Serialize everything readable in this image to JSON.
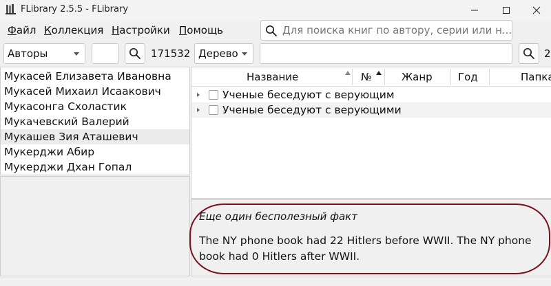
{
  "window": {
    "title": "FLibrary 2.5.5 - FLibrary",
    "controls": [
      "minimize",
      "maximize",
      "close"
    ]
  },
  "menu": {
    "items": [
      "Файл",
      "Коллекция",
      "Настройки",
      "Помощь"
    ]
  },
  "search": {
    "placeholder": "Для поиска книг по автору, серии или н..."
  },
  "toolbar": {
    "navigation_mode": "Авторы",
    "filter_value": "",
    "author_count": "171532",
    "view_mode": "Дерево",
    "books_filter_value": "",
    "books_count": "2"
  },
  "authors": {
    "items": [
      "Мукасей Елизавета Ивановна",
      "Мукасей Михаил Исаакович",
      "Мукасонга Схоластик",
      "Мукачевский Валерий",
      "Мукашев Зия Аташевич",
      "Мукерджи Абир",
      "Мукерджи Дхан Гопал"
    ],
    "selected_index": 4
  },
  "books": {
    "columns": [
      "Название",
      "№",
      "Жанр",
      "Год",
      "Папка"
    ],
    "rows": [
      "Ученые беседуют с верующим",
      "Ученые беседуют с верующими"
    ]
  },
  "fact": {
    "title": "Еще один бесполезный факт",
    "body": "The NY phone book had 22 Hitlers before WWII. The NY phone book had 0 Hitlers after WWII."
  },
  "colors": {
    "annotation_circle": "#7a1020",
    "selected_row": "#ececec",
    "window_bg": "#f0f0f0"
  }
}
